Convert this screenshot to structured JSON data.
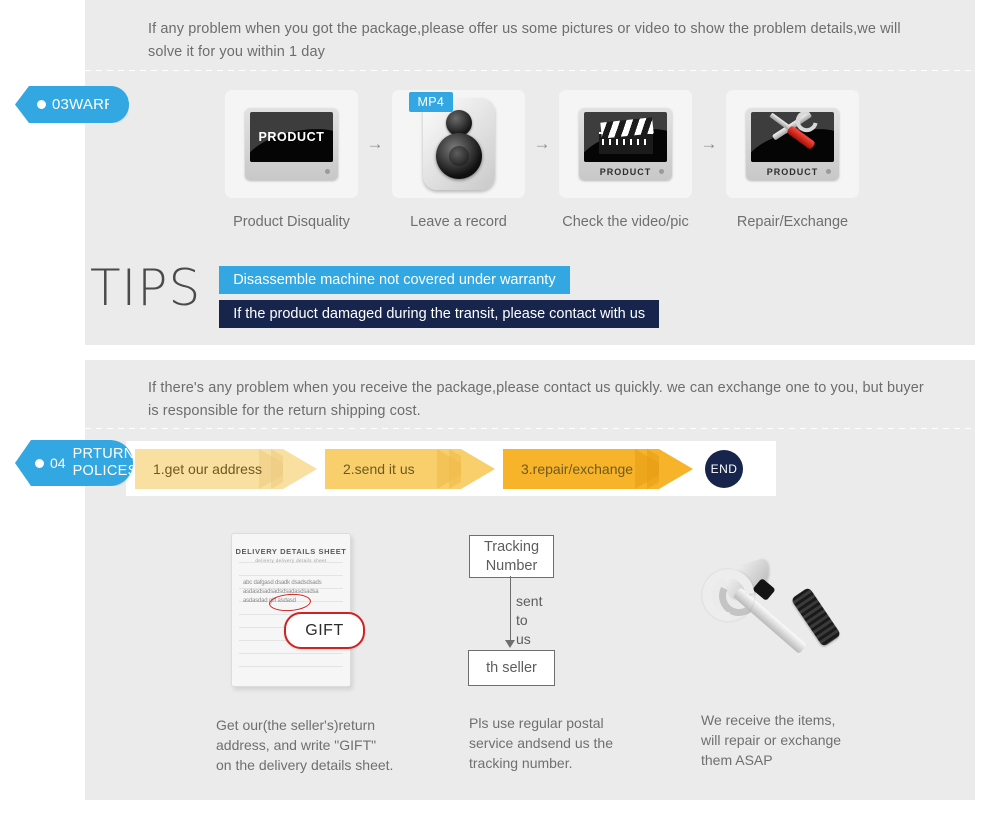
{
  "theme": {
    "panel_bg": "#ebebeb",
    "accent_blue": "#32a7e2",
    "navy": "#17254d",
    "text_gray": "#6f6f6f",
    "chevron_light": "#f9dfa0",
    "chevron_mid": "#f9cf6c",
    "chevron_dark": "#f7b32a",
    "red": "#cf2222"
  },
  "warranty": {
    "badge": {
      "number": "03",
      "label": "WARRANTY"
    },
    "intro": "If any problem when you got the package,please offer us some pictures or video to show the problem details,we will solve it for you within 1 day",
    "steps": [
      {
        "caption": "Product Disquality",
        "icon": "monitor-product-icon",
        "screen_label": "PRODUCT"
      },
      {
        "caption": "Leave a record",
        "icon": "speaker-recorder-icon",
        "tag": "MP4"
      },
      {
        "caption": "Check the video/pic",
        "icon": "monitor-clapperboard-icon",
        "base_label": "PRODUCT"
      },
      {
        "caption": "Repair/Exchange",
        "icon": "monitor-tools-icon",
        "base_label": "PRODUCT"
      }
    ],
    "arrow_glyph": "→",
    "tips": {
      "heading": "TIPS",
      "bars": [
        "Disassemble machine not covered under warranty",
        "If the product damaged during the transit, please contact with us"
      ]
    }
  },
  "returns": {
    "badge": {
      "number": "04",
      "line1": "PRTURN",
      "line2": "POLICES"
    },
    "intro": "If  there's any problem when you receive the package,please contact us quickly. we can exchange one to you, but buyer is responsible for the return shipping cost.",
    "chevrons": [
      {
        "label": "1.get our address"
      },
      {
        "label": "2.send it us"
      },
      {
        "label": "3.repair/exchange"
      }
    ],
    "end_label": "END",
    "columns": [
      {
        "caption": "Get our(the seller's)return\naddress, and write \"GIFT\"\non the delivery details sheet."
      },
      {
        "caption": "Pls use regular postal\nservice andsend us the\n tracking number."
      },
      {
        "caption": "We receive the items,\nwill repair or exchange\n them ASAP"
      }
    ],
    "sheet": {
      "title": "DELIVERY DETAILS SHEET",
      "subtitle": "delivery        delivery details sheet",
      "body_lines": [
        "abc dafgasd dsadk dsadsdsads",
        "asdasdsadsadsdsadasdsadsa",
        "asdasdad gift asdasd"
      ],
      "callout": "GIFT"
    },
    "tracking_flow": {
      "from_box": "Tracking\nNumber",
      "arrow_label": "sent\nto us",
      "to_box": "th seller"
    },
    "tools_icon": "hammer-wrench-screwdriver-icon"
  }
}
